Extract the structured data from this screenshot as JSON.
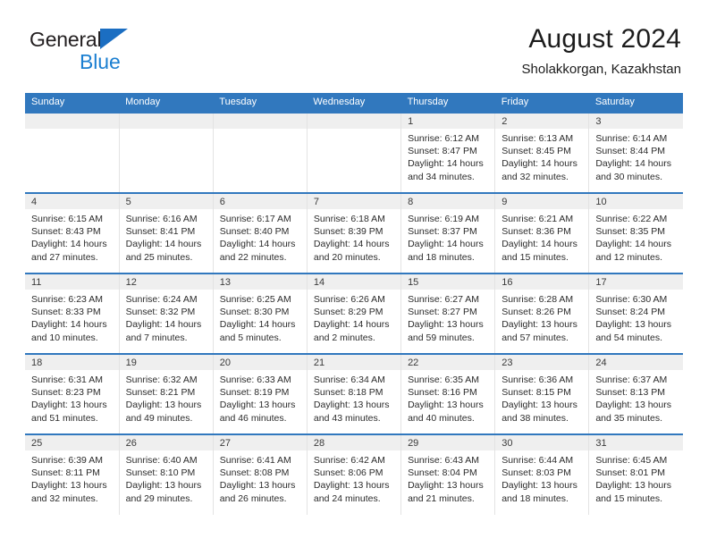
{
  "brand": {
    "name_part1": "General",
    "name_part2": "Blue",
    "logo_icon": "triangle-logo-icon",
    "color_primary": "#1b6ec2",
    "color_secondary": "#1b7fd1"
  },
  "header": {
    "title": "August 2024",
    "subtitle": "Sholakkorgan, Kazakhstan"
  },
  "calendar": {
    "header_bg": "#3178be",
    "header_text_color": "#ffffff",
    "daynum_band_bg": "#efefef",
    "weekday_headers": [
      "Sunday",
      "Monday",
      "Tuesday",
      "Wednesday",
      "Thursday",
      "Friday",
      "Saturday"
    ],
    "weeks": [
      [
        {
          "day": "",
          "empty": true,
          "sunrise": "",
          "sunset": "",
          "daylight_line1": "",
          "daylight_line2": ""
        },
        {
          "day": "",
          "empty": true,
          "sunrise": "",
          "sunset": "",
          "daylight_line1": "",
          "daylight_line2": ""
        },
        {
          "day": "",
          "empty": true,
          "sunrise": "",
          "sunset": "",
          "daylight_line1": "",
          "daylight_line2": ""
        },
        {
          "day": "",
          "empty": true,
          "sunrise": "",
          "sunset": "",
          "daylight_line1": "",
          "daylight_line2": ""
        },
        {
          "day": "1",
          "empty": false,
          "sunrise": "Sunrise: 6:12 AM",
          "sunset": "Sunset: 8:47 PM",
          "daylight_line1": "Daylight: 14 hours",
          "daylight_line2": "and 34 minutes."
        },
        {
          "day": "2",
          "empty": false,
          "sunrise": "Sunrise: 6:13 AM",
          "sunset": "Sunset: 8:45 PM",
          "daylight_line1": "Daylight: 14 hours",
          "daylight_line2": "and 32 minutes."
        },
        {
          "day": "3",
          "empty": false,
          "sunrise": "Sunrise: 6:14 AM",
          "sunset": "Sunset: 8:44 PM",
          "daylight_line1": "Daylight: 14 hours",
          "daylight_line2": "and 30 minutes."
        }
      ],
      [
        {
          "day": "4",
          "empty": false,
          "sunrise": "Sunrise: 6:15 AM",
          "sunset": "Sunset: 8:43 PM",
          "daylight_line1": "Daylight: 14 hours",
          "daylight_line2": "and 27 minutes."
        },
        {
          "day": "5",
          "empty": false,
          "sunrise": "Sunrise: 6:16 AM",
          "sunset": "Sunset: 8:41 PM",
          "daylight_line1": "Daylight: 14 hours",
          "daylight_line2": "and 25 minutes."
        },
        {
          "day": "6",
          "empty": false,
          "sunrise": "Sunrise: 6:17 AM",
          "sunset": "Sunset: 8:40 PM",
          "daylight_line1": "Daylight: 14 hours",
          "daylight_line2": "and 22 minutes."
        },
        {
          "day": "7",
          "empty": false,
          "sunrise": "Sunrise: 6:18 AM",
          "sunset": "Sunset: 8:39 PM",
          "daylight_line1": "Daylight: 14 hours",
          "daylight_line2": "and 20 minutes."
        },
        {
          "day": "8",
          "empty": false,
          "sunrise": "Sunrise: 6:19 AM",
          "sunset": "Sunset: 8:37 PM",
          "daylight_line1": "Daylight: 14 hours",
          "daylight_line2": "and 18 minutes."
        },
        {
          "day": "9",
          "empty": false,
          "sunrise": "Sunrise: 6:21 AM",
          "sunset": "Sunset: 8:36 PM",
          "daylight_line1": "Daylight: 14 hours",
          "daylight_line2": "and 15 minutes."
        },
        {
          "day": "10",
          "empty": false,
          "sunrise": "Sunrise: 6:22 AM",
          "sunset": "Sunset: 8:35 PM",
          "daylight_line1": "Daylight: 14 hours",
          "daylight_line2": "and 12 minutes."
        }
      ],
      [
        {
          "day": "11",
          "empty": false,
          "sunrise": "Sunrise: 6:23 AM",
          "sunset": "Sunset: 8:33 PM",
          "daylight_line1": "Daylight: 14 hours",
          "daylight_line2": "and 10 minutes."
        },
        {
          "day": "12",
          "empty": false,
          "sunrise": "Sunrise: 6:24 AM",
          "sunset": "Sunset: 8:32 PM",
          "daylight_line1": "Daylight: 14 hours",
          "daylight_line2": "and 7 minutes."
        },
        {
          "day": "13",
          "empty": false,
          "sunrise": "Sunrise: 6:25 AM",
          "sunset": "Sunset: 8:30 PM",
          "daylight_line1": "Daylight: 14 hours",
          "daylight_line2": "and 5 minutes."
        },
        {
          "day": "14",
          "empty": false,
          "sunrise": "Sunrise: 6:26 AM",
          "sunset": "Sunset: 8:29 PM",
          "daylight_line1": "Daylight: 14 hours",
          "daylight_line2": "and 2 minutes."
        },
        {
          "day": "15",
          "empty": false,
          "sunrise": "Sunrise: 6:27 AM",
          "sunset": "Sunset: 8:27 PM",
          "daylight_line1": "Daylight: 13 hours",
          "daylight_line2": "and 59 minutes."
        },
        {
          "day": "16",
          "empty": false,
          "sunrise": "Sunrise: 6:28 AM",
          "sunset": "Sunset: 8:26 PM",
          "daylight_line1": "Daylight: 13 hours",
          "daylight_line2": "and 57 minutes."
        },
        {
          "day": "17",
          "empty": false,
          "sunrise": "Sunrise: 6:30 AM",
          "sunset": "Sunset: 8:24 PM",
          "daylight_line1": "Daylight: 13 hours",
          "daylight_line2": "and 54 minutes."
        }
      ],
      [
        {
          "day": "18",
          "empty": false,
          "sunrise": "Sunrise: 6:31 AM",
          "sunset": "Sunset: 8:23 PM",
          "daylight_line1": "Daylight: 13 hours",
          "daylight_line2": "and 51 minutes."
        },
        {
          "day": "19",
          "empty": false,
          "sunrise": "Sunrise: 6:32 AM",
          "sunset": "Sunset: 8:21 PM",
          "daylight_line1": "Daylight: 13 hours",
          "daylight_line2": "and 49 minutes."
        },
        {
          "day": "20",
          "empty": false,
          "sunrise": "Sunrise: 6:33 AM",
          "sunset": "Sunset: 8:19 PM",
          "daylight_line1": "Daylight: 13 hours",
          "daylight_line2": "and 46 minutes."
        },
        {
          "day": "21",
          "empty": false,
          "sunrise": "Sunrise: 6:34 AM",
          "sunset": "Sunset: 8:18 PM",
          "daylight_line1": "Daylight: 13 hours",
          "daylight_line2": "and 43 minutes."
        },
        {
          "day": "22",
          "empty": false,
          "sunrise": "Sunrise: 6:35 AM",
          "sunset": "Sunset: 8:16 PM",
          "daylight_line1": "Daylight: 13 hours",
          "daylight_line2": "and 40 minutes."
        },
        {
          "day": "23",
          "empty": false,
          "sunrise": "Sunrise: 6:36 AM",
          "sunset": "Sunset: 8:15 PM",
          "daylight_line1": "Daylight: 13 hours",
          "daylight_line2": "and 38 minutes."
        },
        {
          "day": "24",
          "empty": false,
          "sunrise": "Sunrise: 6:37 AM",
          "sunset": "Sunset: 8:13 PM",
          "daylight_line1": "Daylight: 13 hours",
          "daylight_line2": "and 35 minutes."
        }
      ],
      [
        {
          "day": "25",
          "empty": false,
          "sunrise": "Sunrise: 6:39 AM",
          "sunset": "Sunset: 8:11 PM",
          "daylight_line1": "Daylight: 13 hours",
          "daylight_line2": "and 32 minutes."
        },
        {
          "day": "26",
          "empty": false,
          "sunrise": "Sunrise: 6:40 AM",
          "sunset": "Sunset: 8:10 PM",
          "daylight_line1": "Daylight: 13 hours",
          "daylight_line2": "and 29 minutes."
        },
        {
          "day": "27",
          "empty": false,
          "sunrise": "Sunrise: 6:41 AM",
          "sunset": "Sunset: 8:08 PM",
          "daylight_line1": "Daylight: 13 hours",
          "daylight_line2": "and 26 minutes."
        },
        {
          "day": "28",
          "empty": false,
          "sunrise": "Sunrise: 6:42 AM",
          "sunset": "Sunset: 8:06 PM",
          "daylight_line1": "Daylight: 13 hours",
          "daylight_line2": "and 24 minutes."
        },
        {
          "day": "29",
          "empty": false,
          "sunrise": "Sunrise: 6:43 AM",
          "sunset": "Sunset: 8:04 PM",
          "daylight_line1": "Daylight: 13 hours",
          "daylight_line2": "and 21 minutes."
        },
        {
          "day": "30",
          "empty": false,
          "sunrise": "Sunrise: 6:44 AM",
          "sunset": "Sunset: 8:03 PM",
          "daylight_line1": "Daylight: 13 hours",
          "daylight_line2": "and 18 minutes."
        },
        {
          "day": "31",
          "empty": false,
          "sunrise": "Sunrise: 6:45 AM",
          "sunset": "Sunset: 8:01 PM",
          "daylight_line1": "Daylight: 13 hours",
          "daylight_line2": "and 15 minutes."
        }
      ]
    ]
  }
}
